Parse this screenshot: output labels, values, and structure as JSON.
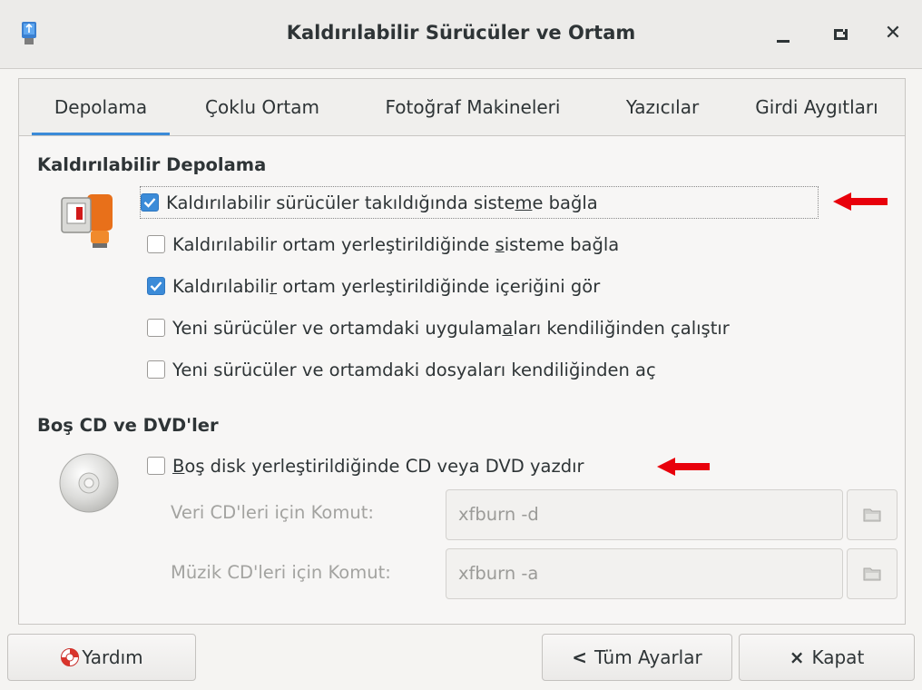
{
  "window": {
    "title": "Kaldırılabilir Sürücüler ve Ortam",
    "app_icon": "usb-drive-icon",
    "controls": [
      "minimize-icon",
      "maximize-icon",
      "close-icon"
    ],
    "close_glyph": "✕"
  },
  "tabs": [
    {
      "label": "Depolama",
      "active": true
    },
    {
      "label": "Çoklu Ortam",
      "active": false
    },
    {
      "label": "Fotoğraf Makineleri",
      "active": false
    },
    {
      "label": "Yazıcılar",
      "active": false
    },
    {
      "label": "Girdi Aygıtları",
      "active": false
    }
  ],
  "storage": {
    "title": "Kaldırılabilir Depolama",
    "icon": "removable-drive-icon",
    "options": [
      {
        "pre": "Kaldırılabilir sürücüler takıldığında siste",
        "mn": "m",
        "post": "e bağla",
        "checked": true
      },
      {
        "pre": "Kaldırılabilir ortam yerleştirildiğinde ",
        "mn": "s",
        "post": "isteme bağla",
        "checked": false
      },
      {
        "pre": "Kaldırılabili",
        "mn": "r",
        "post": " ortam yerleştirildiğinde içeriğini gör",
        "checked": true
      },
      {
        "pre": "Yeni sürücüler ve ortamdaki uygulam",
        "mn": "a",
        "post": "ları kendiliğinden çalıştır",
        "checked": false
      },
      {
        "pre": "Yeni sürücüler ve ortamdaki dosyaları kendiliğinden aç",
        "mn": "",
        "post": "",
        "checked": false
      }
    ]
  },
  "cd_dvd": {
    "title": "Boş CD ve DVD'ler",
    "icon": "optical-disc-icon",
    "burn_option": {
      "pre": "",
      "mn": "B",
      "post": "oş disk yerleştirildiğinde CD veya DVD yazdır",
      "checked": false
    },
    "data_cd": {
      "label": "Veri CD'leri için Komut:",
      "value": "xfburn -d"
    },
    "audio_cd": {
      "label": "Müzik CD'leri için Komut:",
      "value": "xfburn -a"
    }
  },
  "buttons": {
    "help": "Yardım",
    "all_settings": "Tüm Ayarlar",
    "close": "Kapat",
    "all_settings_glyph": "<",
    "close_glyph": "×"
  },
  "colors": {
    "accent": "#3b8bd8",
    "annotation_arrow": "#e8000b"
  }
}
